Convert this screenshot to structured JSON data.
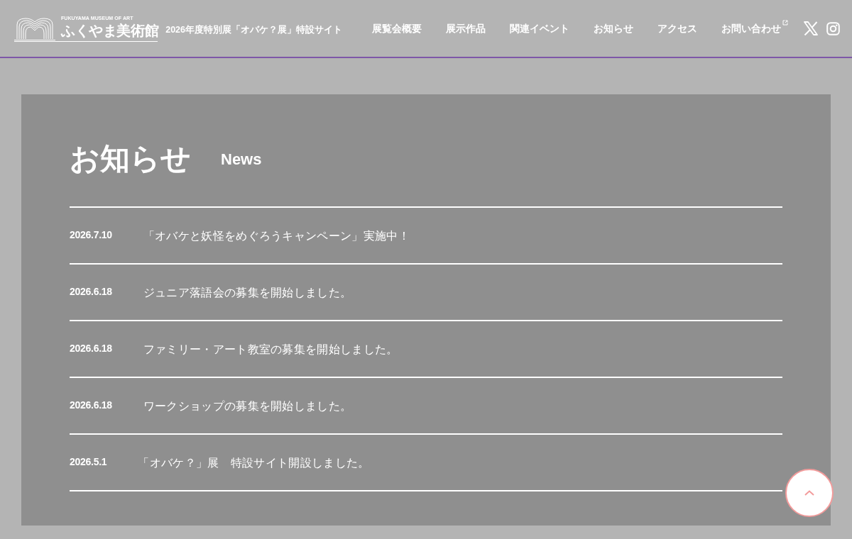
{
  "header": {
    "logo": {
      "caption": "FUKUYAMA MUSEUM OF ART",
      "name": "ふくやま美術館"
    },
    "site_title": "2026年度特別展「オバケ？展」特設サイト",
    "nav": [
      {
        "label": "展覧会概要",
        "external": false
      },
      {
        "label": "展示作品",
        "external": false
      },
      {
        "label": "関連イベント",
        "external": false
      },
      {
        "label": "お知らせ",
        "external": false
      },
      {
        "label": "アクセス",
        "external": false
      },
      {
        "label": "お問い合わせ",
        "external": true
      }
    ],
    "social": [
      {
        "kind": "x"
      },
      {
        "kind": "instagram"
      }
    ]
  },
  "news": {
    "heading": "お知らせ",
    "subheading": "News",
    "items": [
      {
        "date": "2026.7.10",
        "title": "「オバケと妖怪をめぐろうキャンペーン」実施中！"
      },
      {
        "date": "2026.6.18",
        "title": "ジュニア落語会の募集を開始しました。"
      },
      {
        "date": "2026.6.18",
        "title": "ファミリー・アート教室の募集を開始しました。"
      },
      {
        "date": "2026.6.18",
        "title": "ワークショップの募集を開始しました。"
      },
      {
        "date": "2026.5.1",
        "title": "「オバケ？」展　特設サイト開設しました。"
      }
    ]
  }
}
